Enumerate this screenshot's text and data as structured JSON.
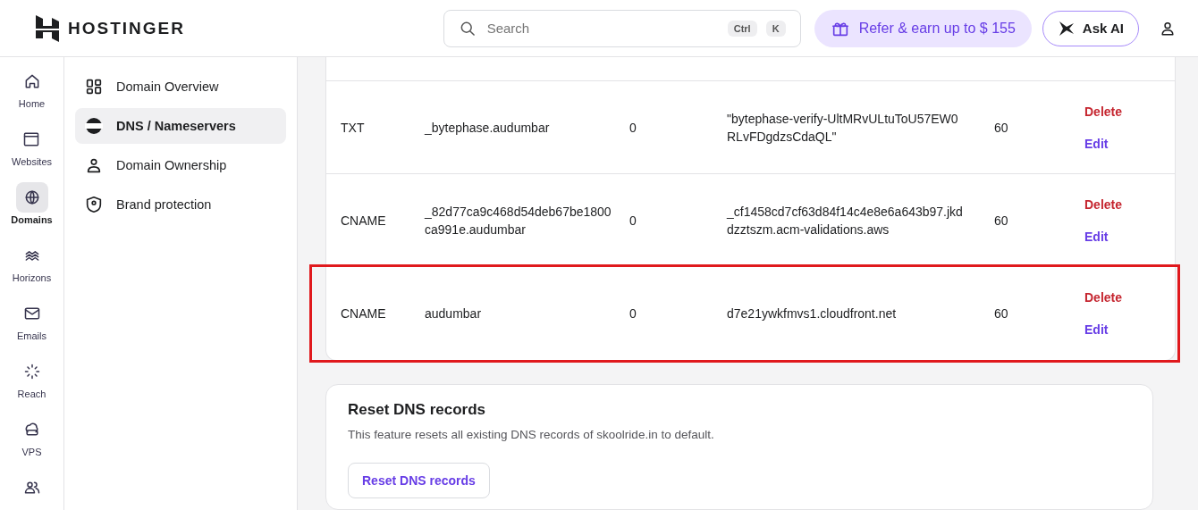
{
  "header": {
    "brand": "HOSTINGER",
    "search": {
      "placeholder": "Search",
      "keys": [
        "Ctrl",
        "K"
      ]
    },
    "refer": "Refer & earn up to $ 155",
    "ask_ai": "Ask AI"
  },
  "rail": [
    {
      "label": "Home",
      "selected": false
    },
    {
      "label": "Websites",
      "selected": false
    },
    {
      "label": "Domains",
      "selected": true
    },
    {
      "label": "Horizons",
      "selected": false
    },
    {
      "label": "Emails",
      "selected": false
    },
    {
      "label": "Reach",
      "selected": false
    },
    {
      "label": "VPS",
      "selected": false
    },
    {
      "selected": false
    }
  ],
  "subnav": [
    {
      "label": "Domain Overview",
      "selected": false
    },
    {
      "label": "DNS / Nameservers",
      "selected": true
    },
    {
      "label": "Domain Ownership",
      "selected": false
    },
    {
      "label": "Brand protection",
      "selected": false
    }
  ],
  "records": [
    {
      "type": "TXT",
      "name": "_bytephase.audumbar",
      "priority": "0",
      "content": "\"bytephase-verify-UltMRvULtuToU57EW0RLvFDgdzsCdaQL\"",
      "ttl": "60",
      "delete": "Delete",
      "edit": "Edit",
      "highlighted": false
    },
    {
      "type": "CNAME",
      "name": "_82d77ca9c468d54deb67be1800ca991e.audumbar",
      "priority": "0",
      "content": "_cf1458cd7cf63d84f14c4e8e6a643b97.jkddzztszm.acm-validations.aws",
      "ttl": "60",
      "delete": "Delete",
      "edit": "Edit",
      "highlighted": false
    },
    {
      "type": "CNAME",
      "name": "audumbar",
      "priority": "0",
      "content": "d7e21ywkfmvs1.cloudfront.net",
      "ttl": "60",
      "delete": "Delete",
      "edit": "Edit",
      "highlighted": true
    }
  ],
  "reset": {
    "title": "Reset DNS records",
    "description": "This feature resets all existing DNS records of skoolride.in to default.",
    "button": "Reset DNS records"
  }
}
